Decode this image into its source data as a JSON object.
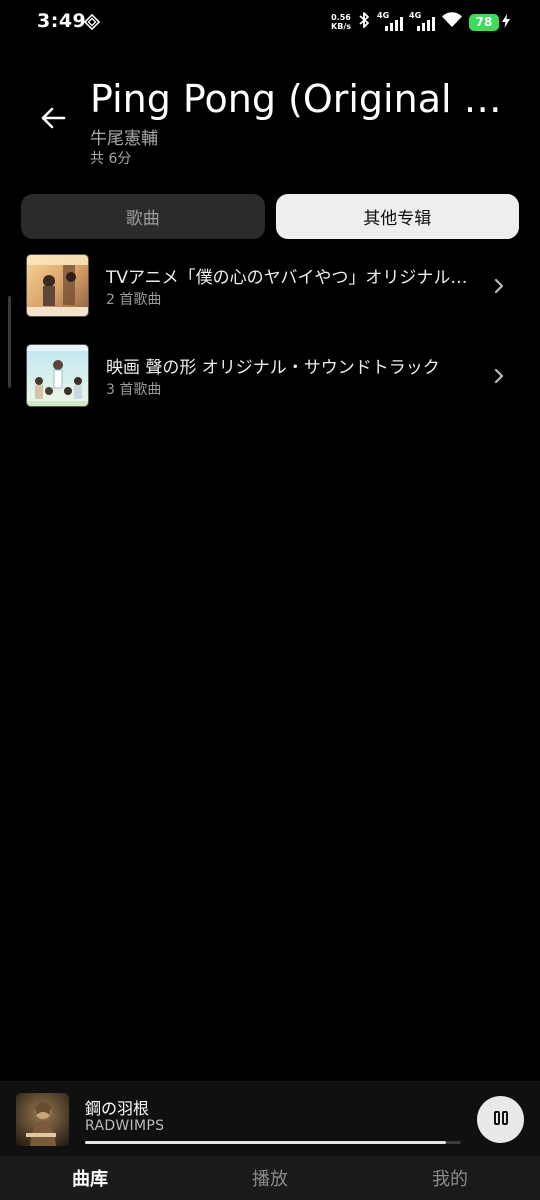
{
  "status_bar": {
    "time": "3:49",
    "net_speed_value": "0.56",
    "net_speed_unit": "KB/s",
    "sim1_label": "4G",
    "sim2_label": "4G",
    "battery_level": "78",
    "battery_color": "#3ddc5a",
    "icons": [
      "vpn-icon",
      "bluetooth-icon",
      "signal-icon",
      "wifi-icon",
      "battery-icon",
      "charging-icon"
    ]
  },
  "header": {
    "title": "Ping Pong (Original Soundtrack)",
    "artist": "牛尾憲輔",
    "duration": "共 6分"
  },
  "tabs": [
    {
      "label": "歌曲",
      "active": false
    },
    {
      "label": "其他专辑",
      "active": true
    }
  ],
  "albums": [
    {
      "name": "TVアニメ「僕の心のヤバイやつ」オリジナル・サウンドトラック",
      "count": "2 首歌曲"
    },
    {
      "name": "映画 聲の形 オリジナル・サウンドトラック",
      "count": "3 首歌曲"
    }
  ],
  "now_playing": {
    "title": "鋼の羽根",
    "artist": "RADWIMPS",
    "progress": 0.96
  },
  "bottom_nav": [
    {
      "label": "曲库",
      "active": true
    },
    {
      "label": "播放",
      "active": false
    },
    {
      "label": "我的",
      "active": false
    }
  ]
}
